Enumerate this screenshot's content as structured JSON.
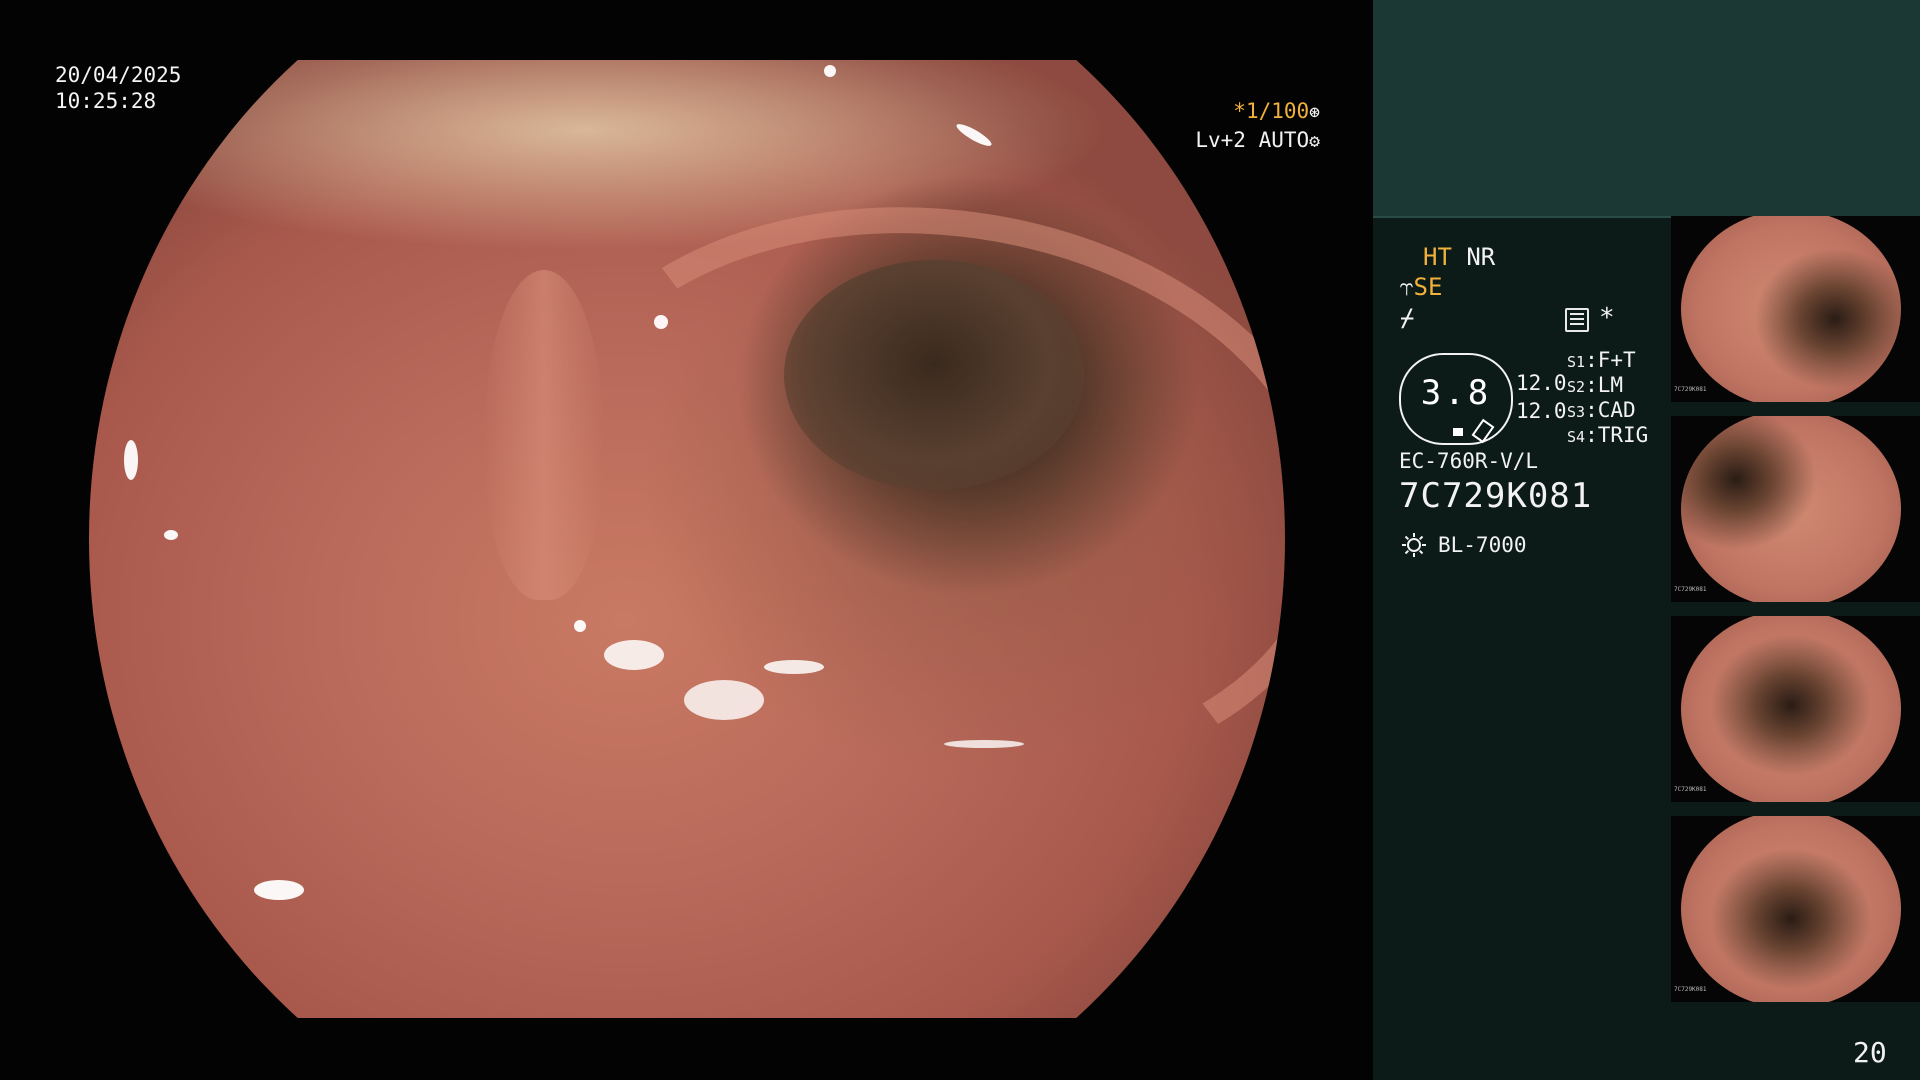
{
  "overlay": {
    "date": "20/04/2025",
    "time": "10:25:28",
    "magnification": "*1/100",
    "level": "Lv+2",
    "mode": "AUTO"
  },
  "panel": {
    "ht_label": "HT",
    "nr_label": "NR",
    "se_label": "SE",
    "score_value": "3.8",
    "value_1": "12.0",
    "value_2": "12.0",
    "slots": [
      {
        "key": "S1",
        "value": "F+T"
      },
      {
        "key": "S2",
        "value": "LM"
      },
      {
        "key": "S3",
        "value": "CAD"
      },
      {
        "key": "S4",
        "value": "TRIG"
      }
    ],
    "scope_model": "EC-760R-V/L",
    "scope_serial": "7C729K081",
    "light_source": "BL-7000",
    "page_number": "20"
  },
  "thumbnails": [
    {
      "name": "capture-1",
      "serial": "7C729K081"
    },
    {
      "name": "capture-2",
      "serial": "7C729K081"
    },
    {
      "name": "capture-3",
      "serial": "7C729K081"
    },
    {
      "name": "capture-4",
      "serial": "7C729K081"
    }
  ],
  "icons": {
    "shutter": "aperture-icon",
    "auto": "auto-exposure-icon",
    "edge": "edge-enhance-icon",
    "sharpness": "sharpness-icon",
    "menu": "menu-icon",
    "star": "star-icon",
    "light": "light-source-icon"
  },
  "colors": {
    "accent": "#f2b13a",
    "panel_bg": "#0c1b18",
    "panel_top": "#1b3834"
  }
}
